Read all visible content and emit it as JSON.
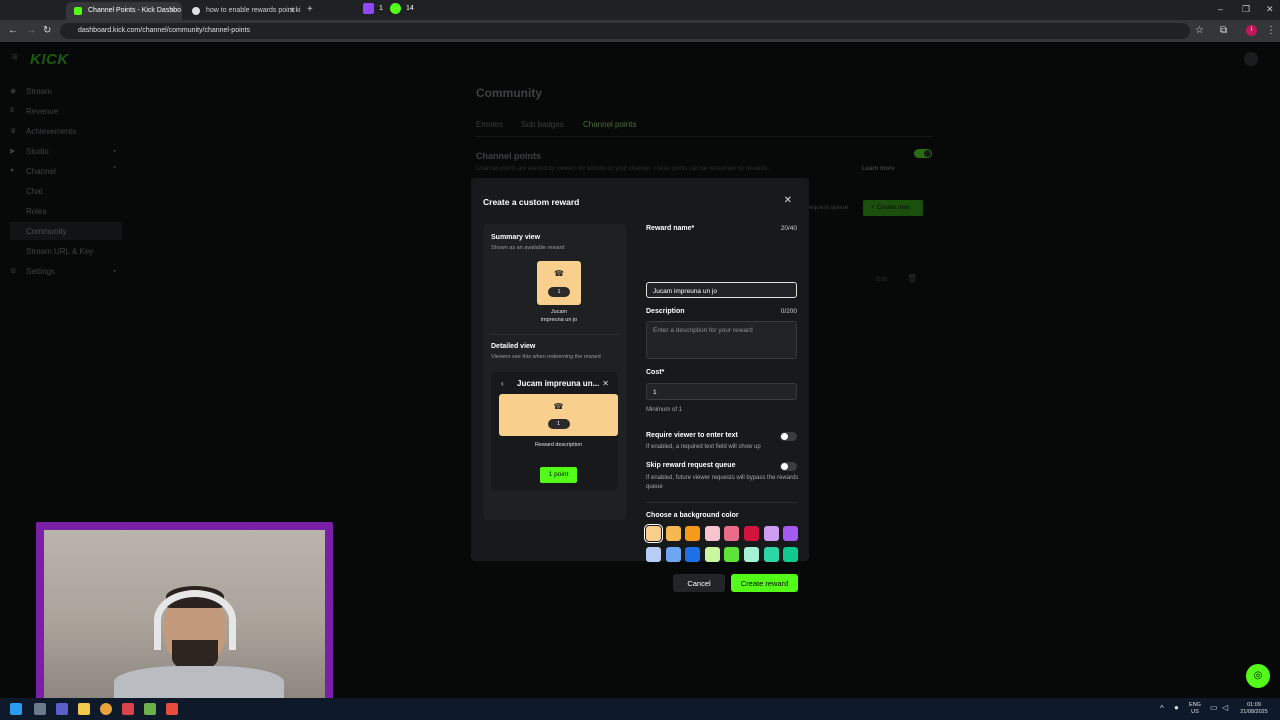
{
  "browser": {
    "tabs": [
      {
        "title": "Channel Points - Kick Dashbo",
        "active": true
      },
      {
        "title": "how to enable rewards point ki",
        "active": false
      }
    ],
    "extensions": {
      "twitch_count": "1",
      "kick_count": "14"
    },
    "url": "dashboard.kick.com/channel/community/channel-points",
    "profile_initial": "I"
  },
  "dashboard": {
    "logo": "KICK",
    "sidebar": [
      {
        "label": "Stream",
        "icon": "broadcast-icon"
      },
      {
        "label": "Revenue",
        "icon": "dollar-icon"
      },
      {
        "label": "Achievements",
        "icon": "trophy-icon"
      },
      {
        "label": "Studio",
        "icon": "video-icon"
      },
      {
        "label": "Channel",
        "icon": "user-icon"
      },
      {
        "label": "Chat",
        "icon": ""
      },
      {
        "label": "Roles",
        "icon": ""
      },
      {
        "label": "Community",
        "icon": ""
      },
      {
        "label": "Stream URL & Key",
        "icon": ""
      },
      {
        "label": "Settings",
        "icon": "gear-icon"
      }
    ],
    "page_title": "Community",
    "tabs": [
      "Emotes",
      "Sub badges",
      "Channel points"
    ],
    "section_title": "Channel points",
    "section_desc": "Channel points are earned by viewers for activity on your channel. These points can be redeemed for rewards.",
    "learn_more": "Learn more",
    "bg_request_queue": "equest queue",
    "bg_create_new": "Create new",
    "bg_edit": "Edit"
  },
  "modal": {
    "title": "Create a custom reward",
    "summary_title": "Summary view",
    "summary_sub": "Shown as an available reward",
    "reward_cost_badge": "1",
    "summary_name_line1": "Jucam",
    "summary_name_line2": "impreuna un jo",
    "detail_title": "Detailed view",
    "detail_sub": "Viewers see this when redeeming the reward",
    "detail_header": "Jucam impreuna un...",
    "detail_desc": "Reward description",
    "detail_point_btn": "1 point",
    "reward_name_label": "Reward name*",
    "reward_name_count": "20/40",
    "reward_name_value": "Jucam impreuna un jo",
    "description_label": "Description",
    "description_count": "0/200",
    "description_placeholder": "Enter a description for your reward",
    "cost_label": "Cost*",
    "cost_value": "1",
    "cost_help": "Minimum of 1",
    "require_text_label": "Require viewer to enter text",
    "require_text_help": "If enabled, a required text field will show up",
    "skip_queue_label": "Skip reward request queue",
    "skip_queue_help": "If enabled, future viewer requests will bypass the rewards queue",
    "color_label": "Choose a background color",
    "colors": [
      "#f9cf8e",
      "#f5b74f",
      "#f59a1a",
      "#f7c3cf",
      "#ea6c8a",
      "#d1143c",
      "#cf9cf4",
      "#a45bf2",
      "#b7cdf4",
      "#6ea6f3",
      "#1d6fe6",
      "#c9f7a0",
      "#5fe33a",
      "#a4f1d6",
      "#2fd6a5",
      "#10c98d"
    ],
    "selected_color": "#f9cf8e",
    "cancel": "Cancel",
    "create": "Create reward"
  },
  "taskbar": {
    "lang": "ENG",
    "region": "US",
    "time": "01:09",
    "date": "21/08/2025"
  }
}
